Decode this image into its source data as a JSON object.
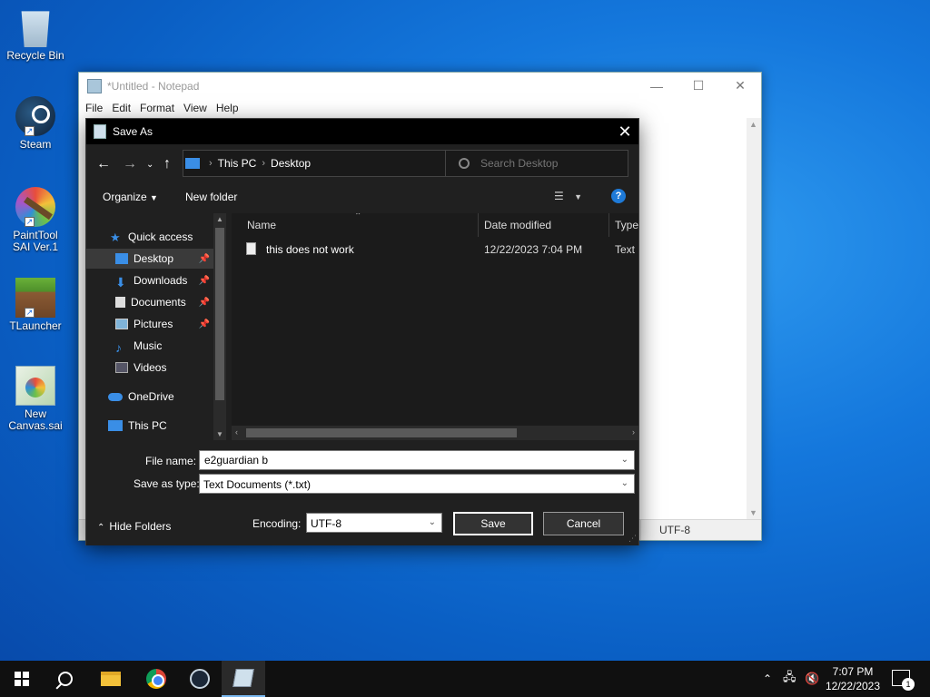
{
  "desktop": {
    "icons": [
      {
        "label": "Recycle Bin"
      },
      {
        "label": "Steam"
      },
      {
        "label": "PaintTool SAI Ver.1"
      },
      {
        "label": "TLauncher"
      },
      {
        "label": "New Canvas.sai"
      }
    ]
  },
  "notepad": {
    "title": "*Untitled - Notepad",
    "menu": [
      "File",
      "Edit",
      "Format",
      "View",
      "Help"
    ],
    "status_encoding": "UTF-8"
  },
  "dialog": {
    "title": "Save As",
    "breadcrumb": [
      "This PC",
      "Desktop"
    ],
    "search_placeholder": "Search Desktop",
    "organize_label": "Organize",
    "new_folder_label": "New folder",
    "help_label": "?",
    "nav": [
      {
        "label": "Quick access"
      },
      {
        "label": "Desktop",
        "selected": true
      },
      {
        "label": "Downloads"
      },
      {
        "label": "Documents"
      },
      {
        "label": "Pictures"
      },
      {
        "label": "Music"
      },
      {
        "label": "Videos"
      },
      {
        "label": "OneDrive"
      },
      {
        "label": "This PC"
      }
    ],
    "columns": [
      "Name",
      "Date modified",
      "Type"
    ],
    "files": [
      {
        "name": "this does not work",
        "date": "12/22/2023 7:04 PM",
        "type": "Text D"
      }
    ],
    "file_name_label": "File name:",
    "file_name_value": "e2guardian b",
    "save_as_type_label": "Save as type:",
    "save_as_type_value": "Text Documents (*.txt)",
    "hide_folders_label": "Hide Folders",
    "encoding_label": "Encoding:",
    "encoding_value": "UTF-8",
    "save_label": "Save",
    "cancel_label": "Cancel"
  },
  "taskbar": {
    "time": "7:07 PM",
    "date": "12/22/2023",
    "notification_count": "1"
  },
  "colors": {
    "accent": "#1e7ad8",
    "dialog_bg": "#202020",
    "desktop_blue": "#1477dc"
  }
}
